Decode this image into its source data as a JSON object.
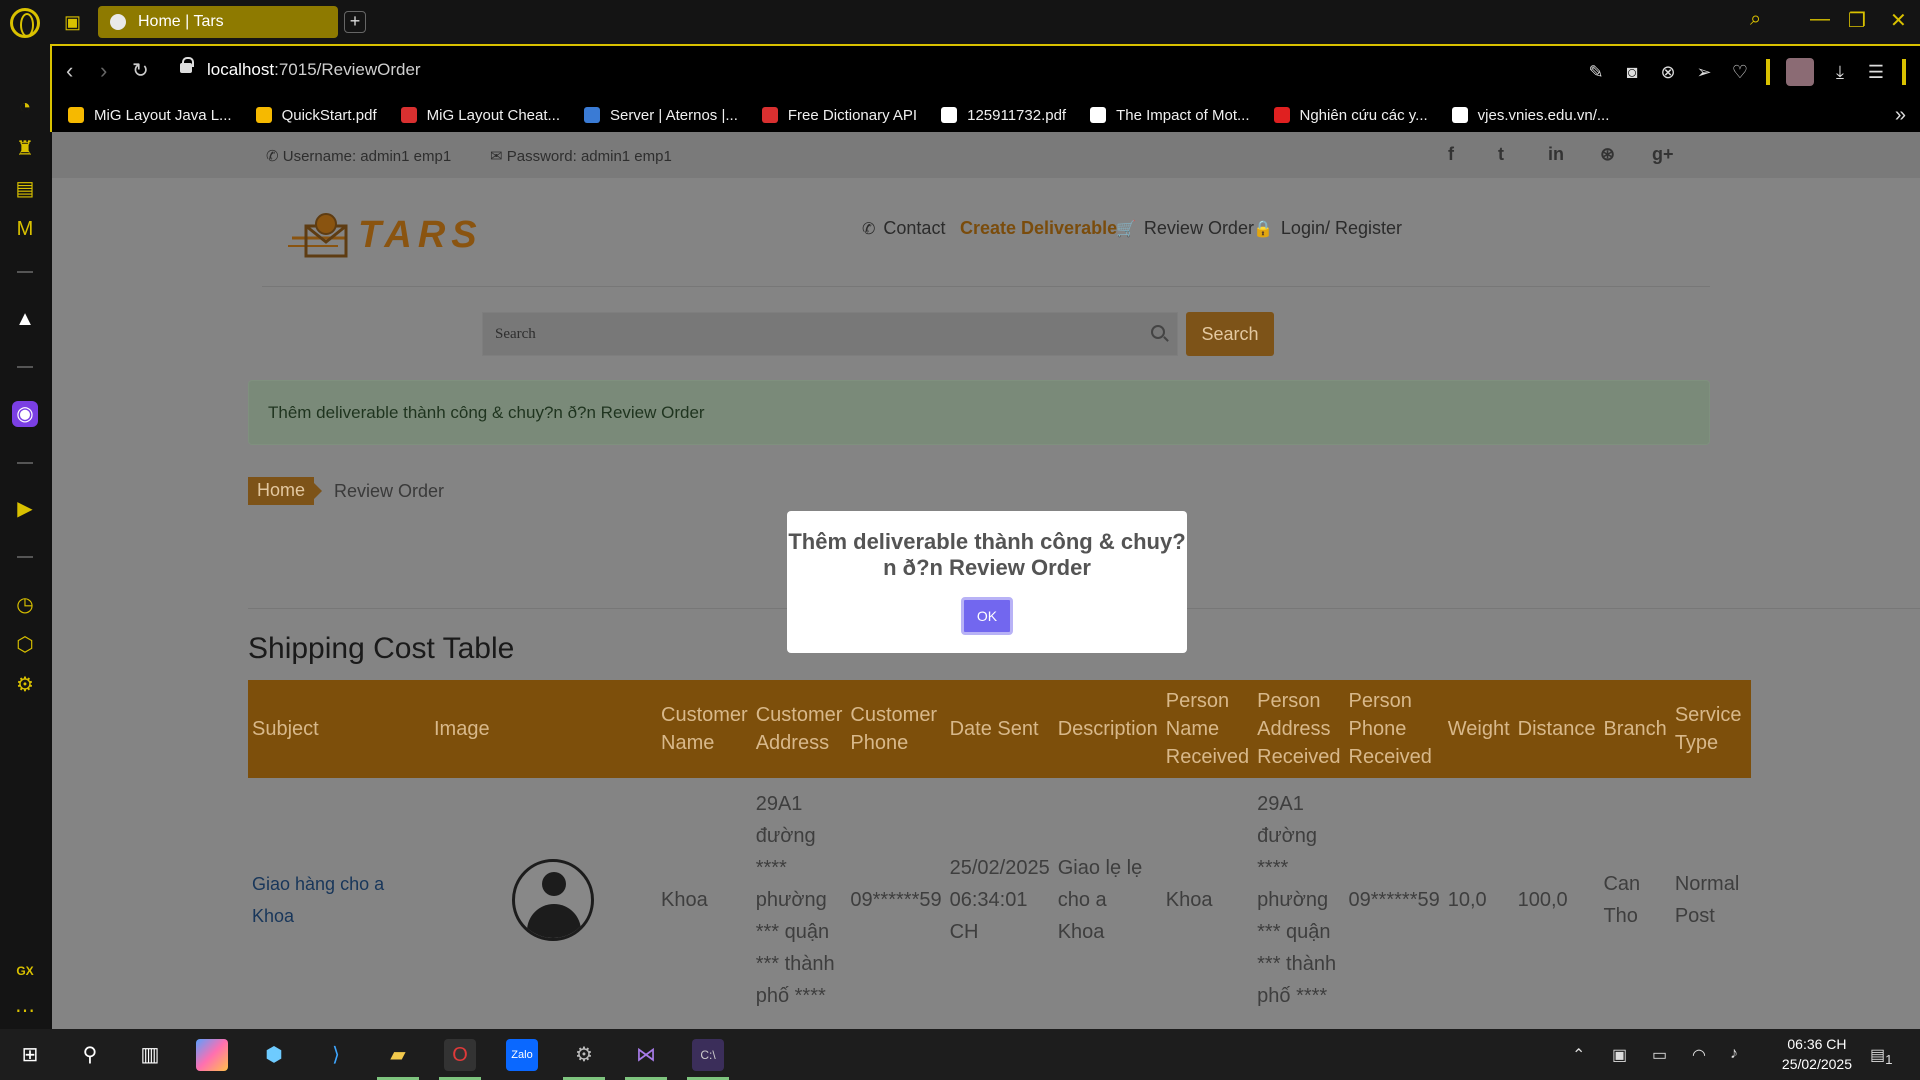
{
  "browser": {
    "tab_title": "Home | Tars",
    "new_tab": "+",
    "url_host": "localhost",
    "url_path": ":7015/ReviewOrder",
    "accent": "#d9c100"
  },
  "bookmarks": [
    {
      "label": "MiG Layout Java L...",
      "color": "#f6b900"
    },
    {
      "label": "QuickStart.pdf",
      "color": "#f6b900"
    },
    {
      "label": "MiG Layout Cheat...",
      "color": "#d93030"
    },
    {
      "label": "Server | Aternos |...",
      "color": "#3a7bd5"
    },
    {
      "label": "Free Dictionary API",
      "color": "#d93030"
    },
    {
      "label": "125911732.pdf",
      "color": "#ffffff"
    },
    {
      "label": "The Impact of Mot...",
      "color": "#ffffff"
    },
    {
      "label": "Nghiên cứu các y...",
      "color": "#e02020"
    },
    {
      "label": "vjes.vnies.edu.vn/...",
      "color": "#ffffff"
    }
  ],
  "topbar": {
    "username": "Username: admin1 emp1",
    "password": "Password: admin1 emp1",
    "social": [
      "f",
      "t",
      "in",
      "⊛",
      "g+"
    ]
  },
  "logo_text": "TARS",
  "nav": {
    "contact": "Contact",
    "create": "Create Deliverable",
    "review": "Review Order",
    "login": "Login/ Register"
  },
  "search": {
    "placeholder": "Search",
    "button": "Search"
  },
  "alert": "Thêm deliverable thành công & chuy?n ð?n Review Order",
  "breadcrumb": {
    "home": "Home",
    "current": "Review Order"
  },
  "table": {
    "title": "Shipping Cost Table",
    "headers": [
      "Subject",
      "Image",
      "Customer Name",
      "Customer Address",
      "Customer Phone",
      "Date Sent",
      "Description",
      "Person Name Received",
      "Person Address Received",
      "Person Phone Received",
      "Weight",
      "Distance",
      "Branch",
      "Service Type"
    ],
    "row": {
      "subject": "Giao hàng cho a Khoa",
      "customer_name": "Khoa",
      "customer_address": "29A1 đường **** phường *** quận *** thành phố ****",
      "customer_phone": "09******59",
      "date_sent": "25/02/2025 06:34:01 CH",
      "description": "Giao lẹ lẹ cho a Khoa",
      "person_name": "Khoa",
      "person_address": "29A1 đường **** phường *** quận *** thành phố ****",
      "person_phone": "09******59",
      "weight": "10,0",
      "distance": "100,0",
      "branch": "Can Tho",
      "service_type": "Normal Post"
    }
  },
  "modal": {
    "message": "Thêm deliverable thành công & chuy?n ð?n Review Order",
    "ok": "OK"
  },
  "taskbar": {
    "time": "06:36 CH",
    "date": "25/02/2025",
    "notifications": "1"
  }
}
